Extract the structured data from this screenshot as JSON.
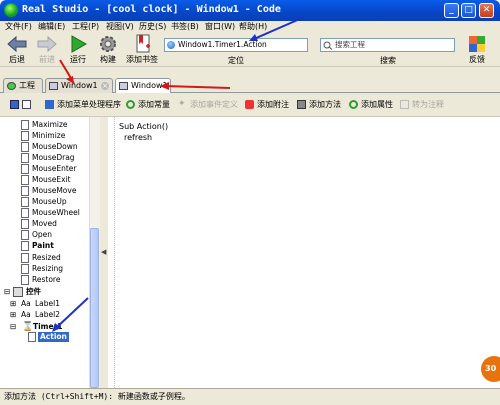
{
  "window": {
    "title": "Real Studio - [cool clock] - Window1 - Code",
    "min_label": "_",
    "max_label": "□",
    "close_label": "✕"
  },
  "menu": [
    "文件(F)",
    "编辑(E)",
    "工程(P)",
    "视图(V)",
    "历史(S)",
    "书签(B)",
    "窗口(W)",
    "帮助(H)"
  ],
  "toolbar": {
    "back": "后退",
    "forward": "前进",
    "run": "运行",
    "build": "构建",
    "add_bookmark": "添加书签",
    "location_value": "Window1.Timer1.Action",
    "location_label": "定位",
    "search_placeholder": "搜索工程",
    "search_label": "搜索",
    "feedback": "反馈"
  },
  "tabs": [
    {
      "label": "工程"
    },
    {
      "label": "Window1"
    },
    {
      "label": "Window1"
    }
  ],
  "editor_toolbar": {
    "add_menu_handler": "添加菜单处理程序",
    "add_constant": "添加常量",
    "add_event_definition": "添加事件定义",
    "add_note": "添加附注",
    "add_method": "添加方法",
    "add_property": "添加属性",
    "convert_comment": "转为注释"
  },
  "tree": {
    "events": [
      "Maximize",
      "Minimize",
      "MouseDown",
      "MouseDrag",
      "MouseEnter",
      "MouseExit",
      "MouseMove",
      "MouseUp",
      "MouseWheel",
      "Moved",
      "Open",
      "Paint",
      "Resized",
      "Resizing",
      "Restore"
    ],
    "controls_label": "控件",
    "controls_prefix": "Aa",
    "label1": "Label1",
    "label2": "Label2",
    "timer": "Timer1",
    "action": "Action",
    "expand_glyph": "⊞",
    "collapse_glyph": "⊟"
  },
  "code": {
    "signature": "Sub Action()",
    "body": "refresh"
  },
  "status": "添加方法 (Ctrl+Shift+M): 新建函数或子例程。",
  "watermark_badge": "30",
  "splitter_arrow": "◀",
  "colors": {
    "titlebar": "#0747c9",
    "chrome": "#ece9d8",
    "selection": "#316ac5",
    "annotation_red": "#d11a1a",
    "annotation_blue": "#1f32c8"
  }
}
